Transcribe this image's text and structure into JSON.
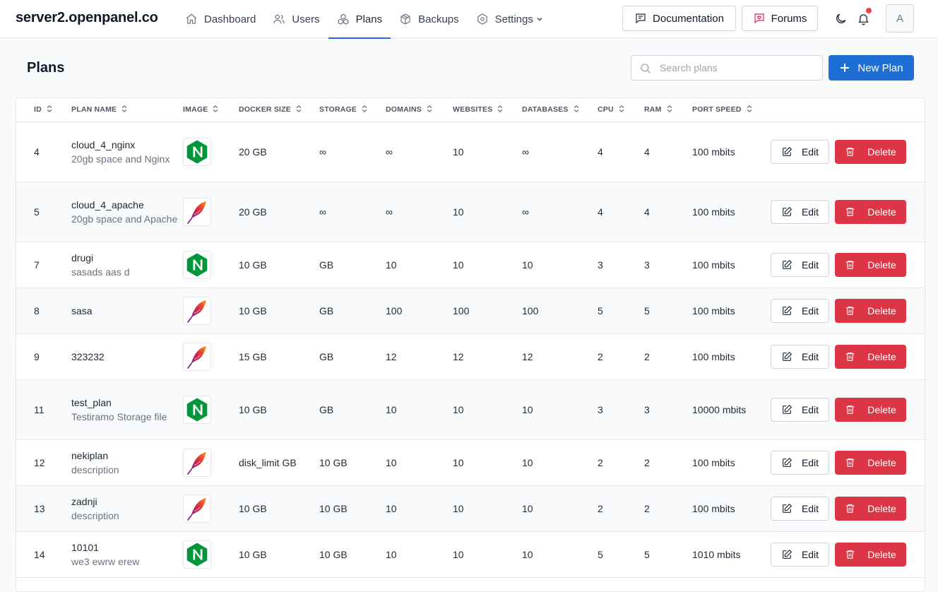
{
  "header": {
    "brand": "server2.openpanel.co",
    "nav": [
      {
        "label": "Dashboard",
        "icon": "home-icon"
      },
      {
        "label": "Users",
        "icon": "users-icon"
      },
      {
        "label": "Plans",
        "icon": "plans-icon",
        "active": true
      },
      {
        "label": "Backups",
        "icon": "box-icon"
      },
      {
        "label": "Settings",
        "icon": "gear-icon",
        "dropdown": true
      }
    ],
    "documentation_label": "Documentation",
    "forums_label": "Forums",
    "avatar_initial": "A",
    "has_notification": true
  },
  "page": {
    "title": "Plans",
    "search_placeholder": "Search plans",
    "search_value": "",
    "new_plan_label": "New Plan"
  },
  "table": {
    "columns": [
      "ID",
      "PLAN NAME",
      "IMAGE",
      "DOCKER SIZE",
      "STORAGE",
      "DOMAINS",
      "WEBSITES",
      "DATABASES",
      "CPU",
      "RAM",
      "PORT SPEED"
    ],
    "edit_label": "Edit",
    "delete_label": "Delete",
    "rows": [
      {
        "id": "4",
        "name": "cloud_4_nginx",
        "description": "20gb space and Nginx",
        "image": "nginx",
        "docker_size": "20 GB",
        "storage": "∞",
        "domains": "∞",
        "websites": "10",
        "databases": "∞",
        "cpu": "4",
        "ram": "4",
        "port_speed": "100 mbits"
      },
      {
        "id": "5",
        "name": "cloud_4_apache",
        "description": "20gb space and Apache",
        "image": "apache",
        "docker_size": "20 GB",
        "storage": "∞",
        "domains": "∞",
        "websites": "10",
        "databases": "∞",
        "cpu": "4",
        "ram": "4",
        "port_speed": "100 mbits"
      },
      {
        "id": "7",
        "name": "drugi",
        "description": "sasads aas d",
        "image": "nginx",
        "docker_size": "10 GB",
        "storage": "GB",
        "domains": "10",
        "websites": "10",
        "databases": "10",
        "cpu": "3",
        "ram": "3",
        "port_speed": "100 mbits"
      },
      {
        "id": "8",
        "name": "sasa",
        "description": "",
        "image": "apache",
        "docker_size": "10 GB",
        "storage": "GB",
        "domains": "100",
        "websites": "100",
        "databases": "100",
        "cpu": "5",
        "ram": "5",
        "port_speed": "100 mbits"
      },
      {
        "id": "9",
        "name": "323232",
        "description": "",
        "image": "apache",
        "docker_size": "15 GB",
        "storage": "GB",
        "domains": "12",
        "websites": "12",
        "databases": "12",
        "cpu": "2",
        "ram": "2",
        "port_speed": "100 mbits"
      },
      {
        "id": "11",
        "name": "test_plan",
        "description": "Testiramo Storage file",
        "image": "nginx",
        "docker_size": "10 GB",
        "storage": "GB",
        "domains": "10",
        "websites": "10",
        "databases": "10",
        "cpu": "3",
        "ram": "3",
        "port_speed": "10000 mbits"
      },
      {
        "id": "12",
        "name": "nekiplan",
        "description": "description",
        "image": "apache",
        "docker_size": "disk_limit GB",
        "storage": "10 GB",
        "domains": "10",
        "websites": "10",
        "databases": "10",
        "cpu": "2",
        "ram": "2",
        "port_speed": "100 mbits"
      },
      {
        "id": "13",
        "name": "zadnji",
        "description": "description",
        "image": "apache",
        "docker_size": "10 GB",
        "storage": "10 GB",
        "domains": "10",
        "websites": "10",
        "databases": "10",
        "cpu": "2",
        "ram": "2",
        "port_speed": "100 mbits"
      },
      {
        "id": "14",
        "name": "10101",
        "description": "we3 ewrw erew",
        "image": "nginx",
        "docker_size": "10 GB",
        "storage": "10 GB",
        "domains": "10",
        "websites": "10",
        "databases": "10",
        "cpu": "5",
        "ram": "5",
        "port_speed": "1010 mbits"
      }
    ]
  },
  "colors": {
    "primary": "#1d6fd6",
    "danger": "#dc3545",
    "nginx": "#009639",
    "notification": "#ef4444"
  }
}
